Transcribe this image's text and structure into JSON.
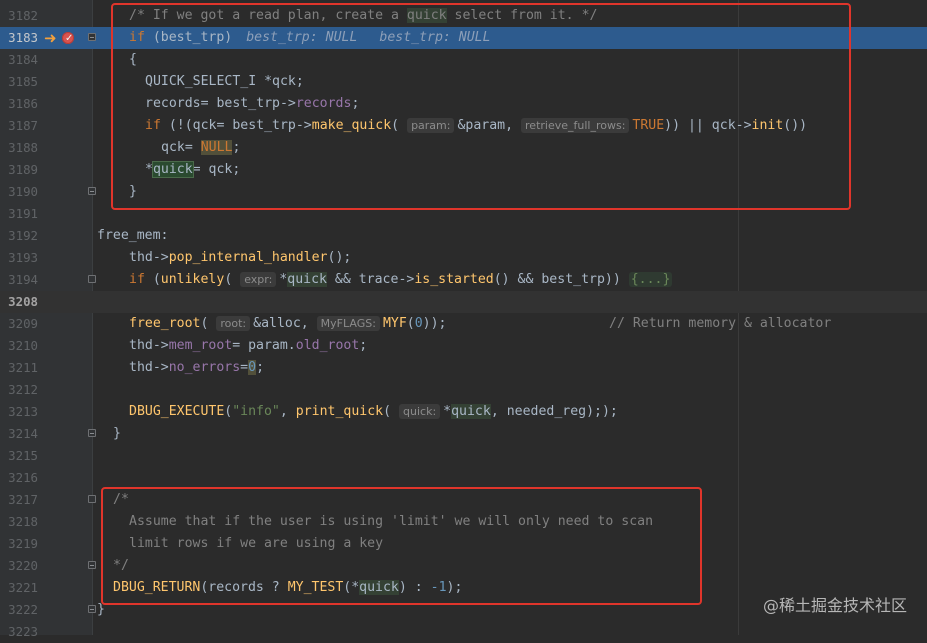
{
  "watermark": "@稀土掘金技术社区",
  "lines": {
    "l3182": {
      "num": "3182",
      "c1": "/* If we got a read plan, create a ",
      "c2": "quick",
      "c3": " select from it. */"
    },
    "l3183": {
      "num": "3183",
      "kw": "if",
      "t1": " (best_trp)",
      "inl1": "best_trp: NULL",
      "inl2": "best_trp: NULL"
    },
    "l3184": {
      "num": "3184",
      "t1": "{"
    },
    "l3185": {
      "num": "3185",
      "t1": "QUICK_SELECT_I *qck;"
    },
    "l3186": {
      "num": "3186",
      "t1": "records= best_trp->",
      "f1": "records",
      "t2": ";"
    },
    "l3187": {
      "num": "3187",
      "kw": "if",
      "t1": " (!(qck= best_trp->",
      "fn": "make_quick",
      "t2": "(",
      "h1": "param:",
      "t3": "&param,",
      "h2": "retrieve_full_rows:",
      "kw2": "TRUE",
      "t4": ")) || qck->",
      "fn2": "init",
      "t5": "())"
    },
    "l3188": {
      "num": "3188",
      "t1": "qck= ",
      "kw": "NULL",
      "t2": ";"
    },
    "l3189": {
      "num": "3189",
      "t1": "*",
      "q": "quick",
      "t2": "= qck;"
    },
    "l3190": {
      "num": "3190",
      "t1": "}"
    },
    "l3191": {
      "num": "3191"
    },
    "l3192": {
      "num": "3192",
      "t1": "free_mem:"
    },
    "l3193": {
      "num": "3193",
      "t1": "thd->",
      "fn": "pop_internal_handler",
      "t2": "();"
    },
    "l3194": {
      "num": "3194",
      "kw": "if",
      "t1": " (",
      "fn": "unlikely",
      "t2": "(",
      "h1": "expr:",
      "t3": "*",
      "q": "quick",
      "t4": " && trace->",
      "fn2": "is_started",
      "t5": "() && best_trp))",
      "ph": "{...}"
    },
    "l3208": {
      "num": "3208"
    },
    "l3209": {
      "num": "3209",
      "fn": "free_root",
      "t1": "(",
      "h1": "root:",
      "t2": "&alloc,",
      "h2": "MyFLAGS:",
      "fn2": "MYF",
      "t3": "(",
      "n1": "0",
      "t4": "));",
      "cm": "// Return memory & allocator"
    },
    "l3210": {
      "num": "3210",
      "t1": "thd->",
      "f1": "mem_root",
      "t2": "= param.",
      "f2": "old_root",
      "t3": ";"
    },
    "l3211": {
      "num": "3211",
      "t1": "thd->",
      "f1": "no_errors",
      "t2": "=",
      "n1": "0",
      "t3": ";"
    },
    "l3212": {
      "num": "3212"
    },
    "l3213": {
      "num": "3213",
      "fn": "DBUG_EXECUTE",
      "t1": "(",
      "s1": "\"info\"",
      "t2": ", ",
      "fn2": "print_quick",
      "t3": "(",
      "h1": "quick:",
      "t4": "*",
      "q": "quick",
      "t5": ", needed_reg););"
    },
    "l3214": {
      "num": "3214",
      "t1": "}"
    },
    "l3215": {
      "num": "3215"
    },
    "l3216": {
      "num": "3216"
    },
    "l3217": {
      "num": "3217",
      "c1": "/*"
    },
    "l3218": {
      "num": "3218",
      "c1": "Assume that if the user is using 'limit' we will only need to scan"
    },
    "l3219": {
      "num": "3219",
      "c1": "limit rows if we are using a key"
    },
    "l3220": {
      "num": "3220",
      "c1": "*/"
    },
    "l3221": {
      "num": "3221",
      "fn": "DBUG_RETURN",
      "t1": "(records ? ",
      "fn2": "MY_TEST",
      "t2": "(*",
      "q": "quick",
      "t3": ") : ",
      "n1": "-1",
      "t4": ");"
    },
    "l3222": {
      "num": "3222",
      "t1": "}"
    },
    "l3223": {
      "num": "3223"
    }
  }
}
